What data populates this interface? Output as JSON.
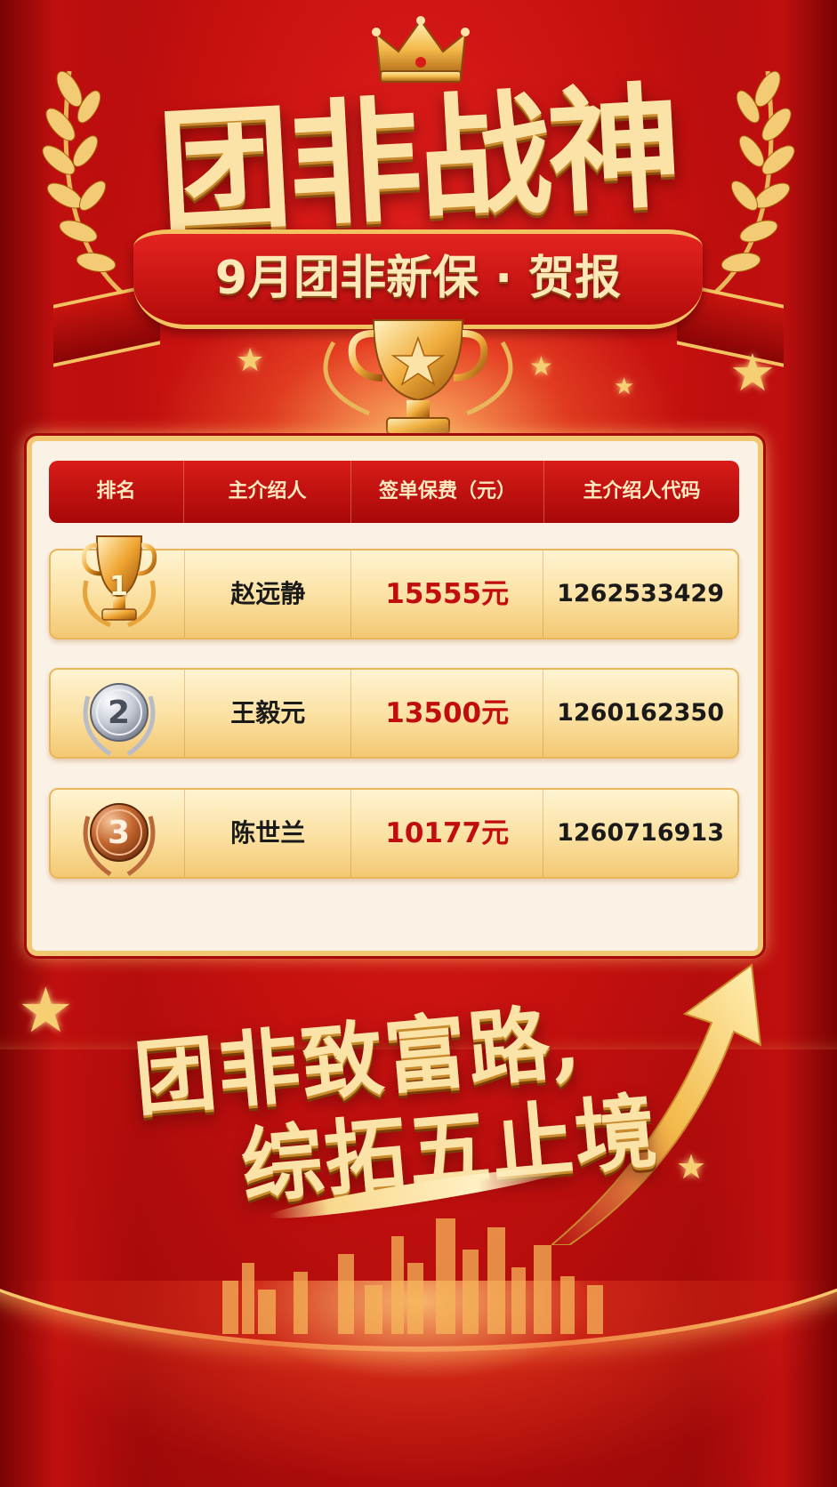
{
  "header": {
    "title": "团非战神",
    "subtitle": "9月团非新保 · 贺报"
  },
  "table": {
    "columns": [
      "排名",
      "主介绍人",
      "签单保费（元）",
      "主介绍人代码"
    ],
    "rows": [
      {
        "rank": "1",
        "medal": "gold-trophy-icon",
        "name": "赵远静",
        "amount": "15555元",
        "code": "1262533429"
      },
      {
        "rank": "2",
        "medal": "silver-medal-icon",
        "name": "王毅元",
        "amount": "13500元",
        "code": "1260162350"
      },
      {
        "rank": "3",
        "medal": "bronze-medal-icon",
        "name": "陈世兰",
        "amount": "10177元",
        "code": "1260716913"
      }
    ]
  },
  "slogan": {
    "line1": "团非致富路,",
    "line2": "综拓五止境"
  },
  "colors": {
    "background_red": "#c4100f",
    "gold": "#f1c772",
    "amount_red": "#c10d0d",
    "header_red": "#b30b0b"
  },
  "icons": [
    "crown-icon",
    "laurel-icon",
    "trophy-icon",
    "star-icon",
    "arrow-up-icon",
    "skyline-icon"
  ]
}
